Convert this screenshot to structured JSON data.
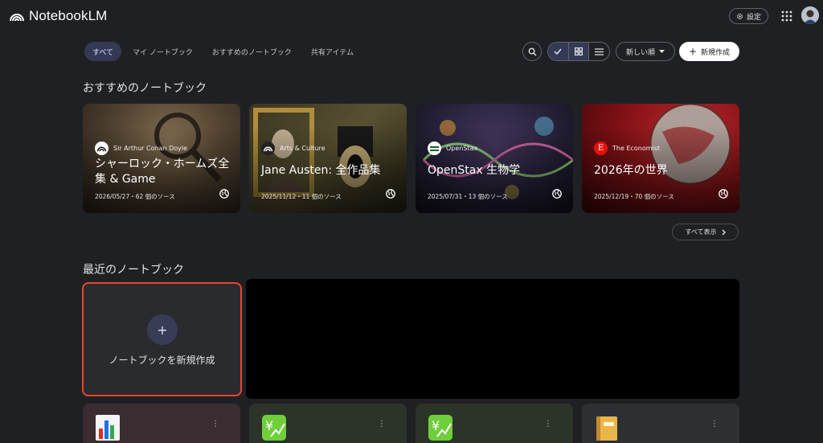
{
  "app": {
    "title": "NotebookLM"
  },
  "header": {
    "settings_label": "設定",
    "apps_icon": "grid-icon",
    "avatar_icon": "user-avatar"
  },
  "filters": {
    "tabs": [
      {
        "label": "すべて",
        "active": true
      },
      {
        "label": "マイ ノートブック",
        "active": false
      },
      {
        "label": "おすすめのノートブック",
        "active": false
      },
      {
        "label": "共有アイテム",
        "active": false
      }
    ]
  },
  "toolbar": {
    "search_icon": "search-icon",
    "view_grid_icon": "grid-view-icon",
    "view_list_icon": "list-view-icon",
    "sort_label": "新しい順",
    "new_label": "新規作成"
  },
  "featured": {
    "heading": "おすすめのノートブック",
    "show_all": "すべて表示",
    "cards": [
      {
        "source": "Sir Arthur Conan Doyle",
        "title": "シャーロック・ホームズ全集 & Game",
        "meta": "2026/05/27・62 個のソース",
        "color": "#6b5a44"
      },
      {
        "source": "Arts & Culture",
        "title": "Jane Austen: 全作品集",
        "meta": "2025/11/12・11 個のソース",
        "color": "#4d4a2f"
      },
      {
        "source": "OpenStax",
        "title": "OpenStax 生物学",
        "meta": "2025/07/31・13 個のソース",
        "color": "#2d2a45"
      },
      {
        "source": "The Economist",
        "title": "2026年の世界",
        "meta": "2025/12/19・70 個のソース",
        "color": "#8c1318"
      }
    ]
  },
  "recent": {
    "heading": "最近のノートブック",
    "create_label": "ノートブックを新規作成",
    "cards": [
      {
        "icon": "bar-chart-emoji-icon",
        "color": "#3a2c30"
      },
      {
        "icon": "yen-chart-emoji-icon",
        "color": "#2c3328"
      },
      {
        "icon": "yen-chart-emoji-icon",
        "color": "#2c3328"
      },
      {
        "icon": "ledger-emoji-icon",
        "color": "#2e2f33"
      }
    ]
  }
}
